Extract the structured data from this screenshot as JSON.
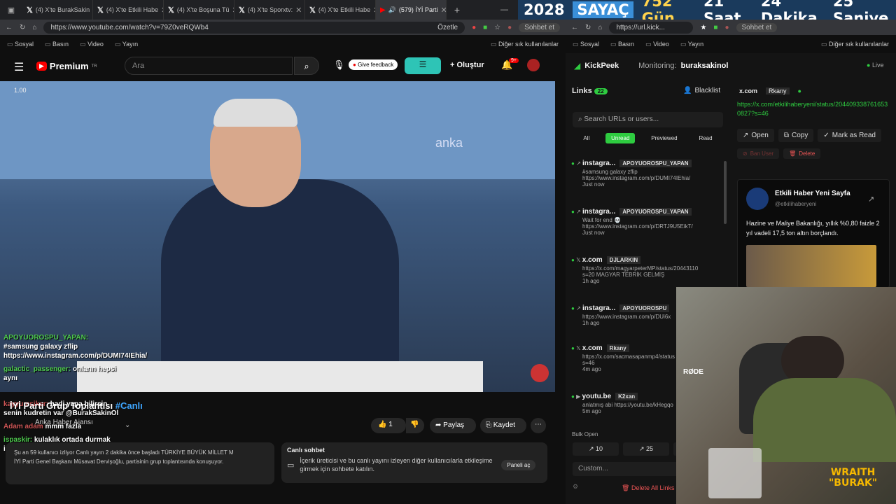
{
  "tabs": [
    {
      "label": "(4) X'te BurakSakin"
    },
    {
      "label": "(4) X'te Etkili Habe"
    },
    {
      "label": "(4) X'te Boşuna Tü"
    },
    {
      "label": "(4) X'te Sporxtv:"
    },
    {
      "label": "(4) X'te Etkili Habe"
    },
    {
      "label": "(579) İYİ Parti"
    }
  ],
  "counter": {
    "year": "2028",
    "title": "SAYAÇ",
    "days": "752 Gün",
    "hours": "21 Saat",
    "minutes": "24 Dakika",
    "seconds": "25 Saniye"
  },
  "left_browser": {
    "url": "https://www.youtube.com/watch?v=79Z0veRQWb4",
    "summary": "Özetle",
    "chat": "Sohbet et"
  },
  "right_browser": {
    "url": "https://url.kick...",
    "chat": "Sohbet et"
  },
  "bookmarks": {
    "b1": "Sosyal",
    "b2": "Basın",
    "b3": "Video",
    "b4": "Yayın",
    "more": "Diğer sık kullanılanlar"
  },
  "youtube": {
    "logo": "Premium",
    "logo_sup": "TR",
    "search_placeholder": "Ara",
    "feedback": "Give feedback",
    "create": "Oluştur",
    "notif_count": "9+",
    "video_badge": "anka",
    "speed": "1.00",
    "title": "İYİ Parti Grup Toplantısı",
    "title_tag": "#Canlı",
    "channel": "Anka Haber Ajansı",
    "likes": "1",
    "share": "Paylaş",
    "save": "Kaydet",
    "desc_line1": "Şu an 59 kullanıcı izliyor  Canlı yayın 2 dakika önce başladı  TÜRKİYE BÜYÜK MİLLET M",
    "desc_line2": "İYİ Parti Genel Başkanı Müsavat Dervişoğlu, partisinin grup toplantısında konuşuyor.",
    "live_chat_title": "Canlı sohbet",
    "live_chat_text": "İçerik üreticisi ve bu canlı yayını izleyen diğer kullanıcılarla etkileşime girmek için sohbete katılın.",
    "open_panel": "Paneli aç"
  },
  "overlay_chat": [
    {
      "name": "APOYUOROSPU_YAPAN:",
      "text": "#samsung galaxy zflip https://www.instagram.com/p/DUMI74IEhia/"
    },
    {
      "name": "galactic_passenger:",
      "text": "onların hepsi aynı"
    },
    {
      "name": "kayyumsiker:",
      "text": "hadi yapa bilirsin senin kudretin var @BurakSakinOl"
    },
    {
      "name": "Adam adam",
      "text": "mmm fazla"
    },
    {
      "name": "ispaskir:",
      "text": "kulaklık ortada durmak istiyor"
    }
  ],
  "kickpeek": {
    "brand": "KickPeek",
    "monitoring_label": "Monitoring:",
    "monitoring_user": "buraksakinol",
    "status": "Live",
    "links_label": "Links",
    "links_count": "22",
    "blacklist": "Blacklist",
    "search_placeholder": "Search URLs or users...",
    "filters": [
      "All",
      "Unread",
      "Previewed",
      "Read"
    ],
    "items": [
      {
        "site": "instagra...",
        "user": "APOYUOROSPU_YAPAN",
        "line1": "#samsung galaxy zflip",
        "line2": "https://www.instagram.com/p/DUMI74IEhia/",
        "time": "Just now"
      },
      {
        "site": "instagra...",
        "user": "APOYUOROSPU_YAPAN",
        "line1": "Wait for end 💀",
        "line2": "https://www.instagram.com/p/DRTJ9U5EikT/",
        "time": "Just now"
      },
      {
        "site": "x.com",
        "user": "DJLARKIN",
        "line1": "https://x.com/magyarpeterMP/status/20443110",
        "line2": "s=20 MAGYAR TEBRİK GELMİŞ",
        "time": "1h ago"
      },
      {
        "site": "instagra...",
        "user": "APOYUOROSPU",
        "line1": "https://www.instagram.com/p/DUi6x",
        "line2": "",
        "time": "1h ago"
      },
      {
        "site": "x.com",
        "user": "Rkany",
        "line1": "https://x.com/sacmasapanmp4/status",
        "line2": "s=46",
        "time": "4m ago"
      },
      {
        "site": "youtu.be",
        "user": "K2xan",
        "line1": "anlatmış abi https://youtu.be/kHegqo",
        "line2": "",
        "time": "5m ago"
      }
    ],
    "bulk_open": "Bulk Open",
    "bulk1": "10",
    "bulk2": "25",
    "bulk3": "50",
    "custom_placeholder": "Custom...",
    "delete_all": "Delete All Links",
    "detail": {
      "site": "x.com",
      "user": "Rkany",
      "url": "https://x.com/etkilihaberyeni/status/2044093387616530827?s=46",
      "open": "Open",
      "copy": "Copy",
      "mark": "Mark as Read",
      "ban": "Ban User",
      "delete": "Delete",
      "account_name": "Etkili Haber Yeni Sayfa",
      "account_handle": "@etkilihaberyeni",
      "tweet": "Hazine ve Maliye Bakanlığı, yıllık %0,80 faizle 2 yıl vadeli 17,5 ton altın borçlandı."
    }
  },
  "webcam": {
    "mic_brand": "RØDE",
    "logo_line1": "WRAITH",
    "logo_line2": "\"BURAK\""
  }
}
